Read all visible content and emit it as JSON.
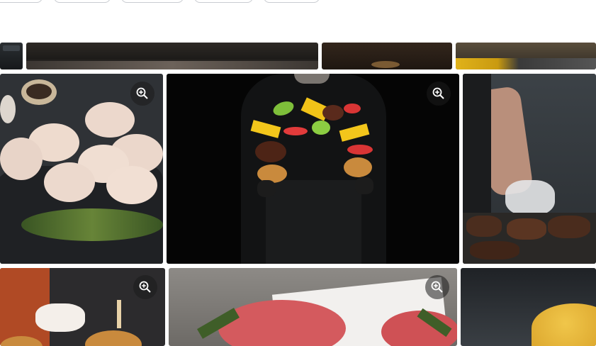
{
  "filter_chips": [
    "",
    "",
    "",
    "",
    ""
  ],
  "grid": {
    "row1": [
      {
        "name": "top-thumb-1",
        "icon": "zoom-in-icon"
      },
      {
        "name": "top-thumb-2",
        "icon": "zoom-in-icon"
      },
      {
        "name": "top-thumb-3",
        "icon": "zoom-in-icon"
      },
      {
        "name": "top-thumb-4",
        "icon": "zoom-in-icon"
      }
    ],
    "row2": [
      {
        "name": "raw-chicken-patties-photo",
        "icon": "zoom-in-icon"
      },
      {
        "name": "chef-flying-burger-ingredients-photo",
        "icon": "zoom-in-icon"
      },
      {
        "name": "chef-grilling-patties-photo",
        "icon": "zoom-in-icon"
      }
    ],
    "row3": [
      {
        "name": "hands-assembling-burger-photo",
        "icon": "zoom-in-icon"
      },
      {
        "name": "raw-beef-patties-photo",
        "icon": "zoom-in-icon"
      },
      {
        "name": "sesame-bun-photo",
        "icon": "zoom-in-icon"
      }
    ]
  },
  "colors": {
    "zoom_overlay": "#1c1c1c",
    "page_bg": "#ffffff"
  }
}
